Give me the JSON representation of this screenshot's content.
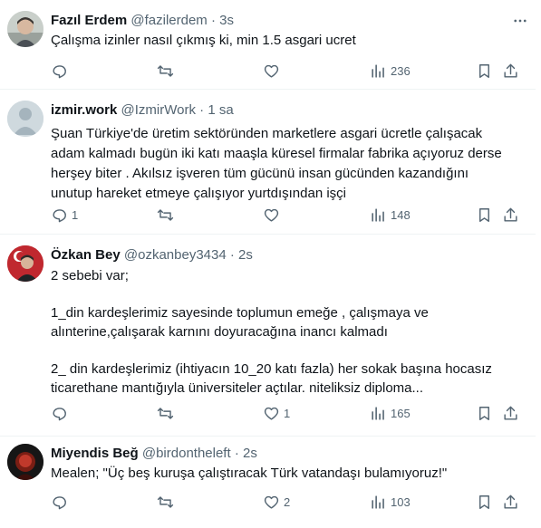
{
  "tweets": [
    {
      "name": "Fazıl Erdem",
      "handle": "@fazilerdem",
      "time": "3s",
      "lines": [
        "Çalışma izinler nasıl çıkmış ki, min 1.5 asgari ucret"
      ],
      "replies": "",
      "likes": "",
      "views": "236"
    },
    {
      "name": "izmir.work",
      "handle": "@IzmirWork",
      "time": "1 sa",
      "lines": [
        "Şuan Türkiye'de üretim sektöründen marketlere asgari ücretle çalışacak",
        "adam kalmadı bugün iki katı maaşla küresel firmalar fabrika açıyoruz derse",
        "herşey biter . Akılsız işveren tüm gücünü insan gücünden kazandığını",
        "unutup hareket etmeye çalışıyor yurtdışından işçi"
      ],
      "replies": "1",
      "likes": "",
      "views": "148"
    },
    {
      "name": "Özkan Bey",
      "handle": "@ozkanbey3434",
      "time": "2s",
      "lines": [
        "2 sebebi var;",
        "",
        "1_din kardeşlerimiz sayesinde toplumun emeğe , çalışmaya ve",
        "alınterine,çalışarak karnını doyuracağına  inancı kalmadı",
        "",
        "2_ din kardeşlerimiz (ihtiyacın 10_20 katı fazla) her sokak başına hocasız",
        "ticarethane mantığıyla üniversiteler açtılar. niteliksiz diploma..."
      ],
      "replies": "",
      "likes": "1",
      "views": "165"
    },
    {
      "name": "Miyendis Beğ",
      "handle": "@birdontheleft",
      "time": "2s",
      "lines": [
        "Mealen; \"Üç beş kuruşa çalıştıracak Türk vatandaşı bulamıyoruz!\""
      ],
      "replies": "",
      "likes": "2",
      "views": "103"
    }
  ],
  "icons": {
    "reply": "reply-icon",
    "retweet": "retweet-icon",
    "like": "like-icon",
    "views": "views-icon",
    "bookmark": "bookmark-icon",
    "share": "share-icon",
    "more": "more-icon"
  },
  "colors": {
    "text": "#0f1419",
    "secondary": "#536471",
    "divider": "#eff3f4"
  }
}
